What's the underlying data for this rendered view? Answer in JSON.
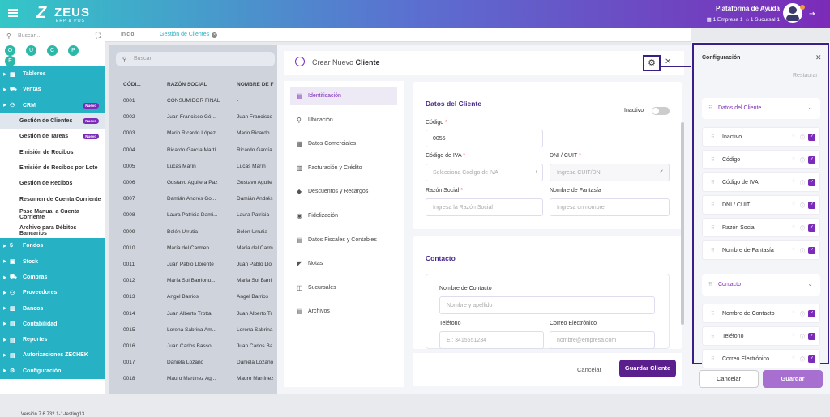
{
  "header": {
    "brand": "ZEUS",
    "brand_sub": "ERP & POS",
    "help": "Plataforma de Ayuda",
    "company": "1 Empresa 1",
    "branch": "1 Sucursal 1"
  },
  "sidebar": {
    "search_placeholder": "Buscar...",
    "quick": [
      "O",
      "U",
      "C",
      "P",
      "E"
    ],
    "items": [
      {
        "label": "Tableros",
        "type": "main"
      },
      {
        "label": "Ventas",
        "type": "main"
      },
      {
        "label": "CRM",
        "type": "main",
        "badge": "Nuevo"
      },
      {
        "label": "Gestión de Clientes",
        "type": "sub",
        "badge": "Nuevo",
        "active": true
      },
      {
        "label": "Gestión de Tareas",
        "type": "sub",
        "badge": "Nuevo"
      },
      {
        "label": "Emisión de Recibos",
        "type": "sub"
      },
      {
        "label": "Emisión de Recibos por Lote",
        "type": "sub"
      },
      {
        "label": "Gestión de Recibos",
        "type": "sub"
      },
      {
        "label": "Resumen de Cuenta Corriente",
        "type": "sub"
      },
      {
        "label": "Pase Manual a Cuenta Corriente",
        "type": "sub"
      },
      {
        "label": "Archivo para Débitos Bancarios",
        "type": "sub"
      },
      {
        "label": "Fondos",
        "type": "main"
      },
      {
        "label": "Stock",
        "type": "main"
      },
      {
        "label": "Compras",
        "type": "main"
      },
      {
        "label": "Proveedores",
        "type": "main"
      },
      {
        "label": "Bancos",
        "type": "main"
      },
      {
        "label": "Contabilidad",
        "type": "main"
      },
      {
        "label": "Reportes",
        "type": "main"
      },
      {
        "label": "Autorizaciones ZECHEK",
        "type": "main"
      },
      {
        "label": "Configuración",
        "type": "main"
      }
    ],
    "version": "Versión 7.6.732.1-1-testing13"
  },
  "tabs": [
    "Inicio",
    "Gestión de Clientes"
  ],
  "list": {
    "search_placeholder": "Buscar",
    "columns": [
      "CÓDI...",
      "RAZÓN SOCIAL",
      "NOMBRE DE F"
    ],
    "rows": [
      [
        "0001",
        "CONSUMIDOR FINAL",
        "-"
      ],
      [
        "0002",
        "Juan Francisco Gó...",
        "Juan Francisco"
      ],
      [
        "0003",
        "Mario Ricardo López",
        "Mario Ricardo"
      ],
      [
        "0004",
        "Ricardo García Martí",
        "Ricardo García"
      ],
      [
        "0005",
        "Lucas Marín",
        "Lucas Marín"
      ],
      [
        "0006",
        "Gustavo Aguilera Paz",
        "Gustavo Aguile"
      ],
      [
        "0007",
        "Damián Andrés Go...",
        "Damián Andrés"
      ],
      [
        "0008",
        "Laura Patricia Dami...",
        "Laura Patricia"
      ],
      [
        "0009",
        "Belén Urrutia",
        "Belén Urrutia"
      ],
      [
        "0010",
        "María del Carmen ...",
        "María del Carm"
      ],
      [
        "0011",
        "Juan Pablo Llorente",
        "Juan Pablo Llo"
      ],
      [
        "0012",
        "María Sol Barrionu...",
        "María Sol Barri"
      ],
      [
        "0013",
        "Angel Barrios",
        "Angel Barrios"
      ],
      [
        "0014",
        "Juan Alberto Trotta",
        "Juan Alberto Tr"
      ],
      [
        "0015",
        "Lorena Sabrina Am...",
        "Lorena Sabrina"
      ],
      [
        "0016",
        "Juan Carlos Basso",
        "Juan Carlos Ba"
      ],
      [
        "0017",
        "Daniela Lozano",
        "Daniela Lozano"
      ],
      [
        "0018",
        "Mauro Martínez Ag...",
        "Mauro Martínez"
      ]
    ]
  },
  "modal": {
    "title_prefix": "Crear Nuevo",
    "title_strong": "Cliente",
    "nav": [
      {
        "label": "Identificación",
        "active": true
      },
      {
        "label": "Ubicación"
      },
      {
        "label": "Datos Comerciales"
      },
      {
        "label": "Facturación y Crédito"
      },
      {
        "label": "Descuentos y Recargos"
      },
      {
        "label": "Fidelización"
      },
      {
        "label": "Datos Fiscales y Contables"
      },
      {
        "label": "Notas"
      },
      {
        "label": "Sucursales"
      },
      {
        "label": "Archivos"
      }
    ],
    "client_section": "Datos del Cliente",
    "inactive_label": "Inactivo",
    "code_label": "Código",
    "code_value": "0055",
    "iva_label": "Código de IVA",
    "iva_placeholder": "Selecciona Código de IVA",
    "dni_label": "DNI / CUIT",
    "dni_placeholder": "Ingresa CUIT/DNI",
    "razon_label": "Razón Social",
    "razon_placeholder": "Ingresa la Razón Social",
    "fantasia_label": "Nombre de Fantasía",
    "fantasia_placeholder": "Ingresa un nombre",
    "contact_section": "Contacto",
    "contact_name_label": "Nombre de Contacto",
    "contact_name_placeholder": "Nombre y apellido",
    "phone_label": "Teléfono",
    "phone_placeholder": "Ej: 3415551234",
    "email_label": "Correo Electrónico",
    "email_placeholder": "nombre@empresa.com",
    "cancel": "Cancelar",
    "save": "Guardar Cliente"
  },
  "config": {
    "title": "Configuración",
    "restore": "Restaurar",
    "sections": [
      {
        "title": "Datos del Cliente",
        "items": [
          "Inactivo",
          "Código",
          "Código de IVA",
          "DNI / CUIT",
          "Razón Social",
          "Nombre de Fantasía"
        ]
      },
      {
        "title": "Contacto",
        "items": [
          "Nombre de Contacto",
          "Teléfono",
          "Correo Electrónico"
        ]
      }
    ],
    "cancel": "Cancelar",
    "save": "Guardar"
  },
  "colors": {
    "accent": "#7b2bb8",
    "teal": "#27b1c4",
    "highlight": "#3b1f88"
  }
}
